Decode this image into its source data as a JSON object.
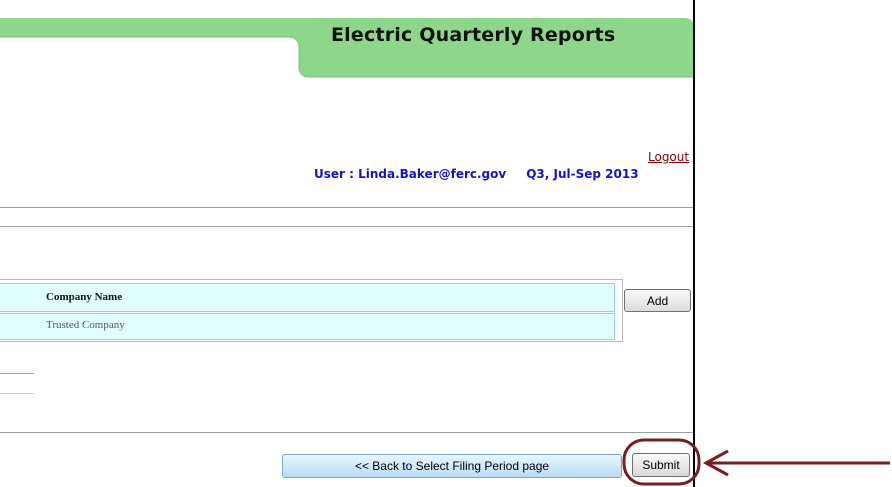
{
  "app": {
    "title": "Electric Quarterly Reports"
  },
  "header": {
    "logout_label": "Logout",
    "user_label": "User : Linda.Baker@ferc.gov",
    "period_label": "Q3, Jul-Sep 2013"
  },
  "companies_table": {
    "columns": [
      "Company Name"
    ],
    "rows": [
      [
        "Trusted Company"
      ]
    ]
  },
  "buttons": {
    "add": "Add",
    "back": "<< Back to Select Filing Period page",
    "submit": "Submit"
  },
  "colors": {
    "tab_green": "#8ed68a",
    "user_text": "#1414c8",
    "grid_bg": "#e0ffff",
    "annotation": "#7a1f1f"
  },
  "annotation": {
    "highlighted": "Submit",
    "arrow_icon": "arrow-left-icon"
  }
}
